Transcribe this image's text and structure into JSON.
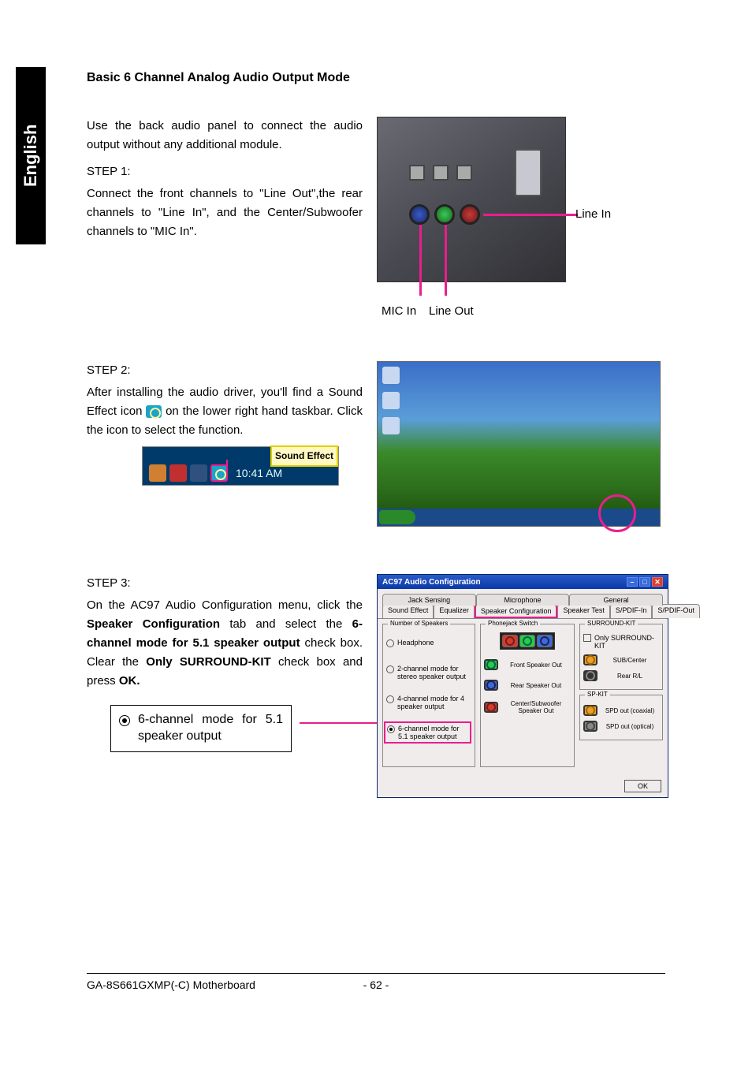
{
  "language_tab": "English",
  "section_title": "Basic 6 Channel Analog Audio Output Mode",
  "intro": "Use the back audio panel to connect the audio output without any additional module.",
  "step1": {
    "heading": "STEP 1:",
    "body": "Connect the front channels to \"Line Out\",the rear channels to \"Line In\", and the Center/Subwoofer channels to \"MIC In\".",
    "label_linein": "Line In",
    "label_micin": "MIC In",
    "label_lineout": "Line Out"
  },
  "step2": {
    "heading": "STEP 2:",
    "body_a": "After installing the audio driver, you'll find a Sound Effect  icon ",
    "body_b": " on the lower right hand taskbar. Click the icon to select the function.",
    "tooltip": "Sound Effect",
    "time": "10:41 AM"
  },
  "step3": {
    "heading": "STEP 3:",
    "body_a": "On the AC97 Audio Configuration menu, click the ",
    "bold_a": "Speaker Configuration",
    "body_b": " tab and select the ",
    "bold_b": "6-channel mode for 5.1 speaker output",
    "body_c": " check box. Clear the ",
    "bold_c": "Only SURROUND-KIT",
    "body_d": " check box and press ",
    "bold_d": "OK.",
    "callout_radio": "6-channel mode for 5.1 speaker output"
  },
  "ac97": {
    "title": "AC97 Audio Configuration",
    "tabs_row1": [
      "Jack Sensing",
      "Microphone",
      "General"
    ],
    "tabs_row2": [
      "Sound Effect",
      "Equalizer",
      "Speaker Configuration",
      "Speaker Test",
      "S/PDIF-In",
      "S/PDIF-Out"
    ],
    "group_speakers": "Number of Speakers",
    "opt_headphone": "Headphone",
    "opt_2ch": "2-channel mode for stereo speaker output",
    "opt_4ch": "4-channel mode for 4 speaker output",
    "opt_6ch": "6-channel mode for 5.1 speaker output",
    "group_phonejack": "Phonejack Switch",
    "lbl_front": "Front Speaker Out",
    "lbl_rear": "Rear Speaker Out",
    "lbl_center": "Center/Subwoofer Speaker Out",
    "group_surround": "SURROUND-KIT",
    "chk_only": "Only SURROUND-KIT",
    "lbl_subcenter": "SUB/Center",
    "lbl_rearrl": "Rear R/L",
    "group_spkit": "SP-KIT",
    "lbl_spd_coax": "SPD out (coaxial)",
    "lbl_spd_opt": "SPD out (optical)",
    "ok": "OK"
  },
  "footer": {
    "left": "GA-8S661GXMP(-C) Motherboard",
    "page": "- 62 -"
  }
}
